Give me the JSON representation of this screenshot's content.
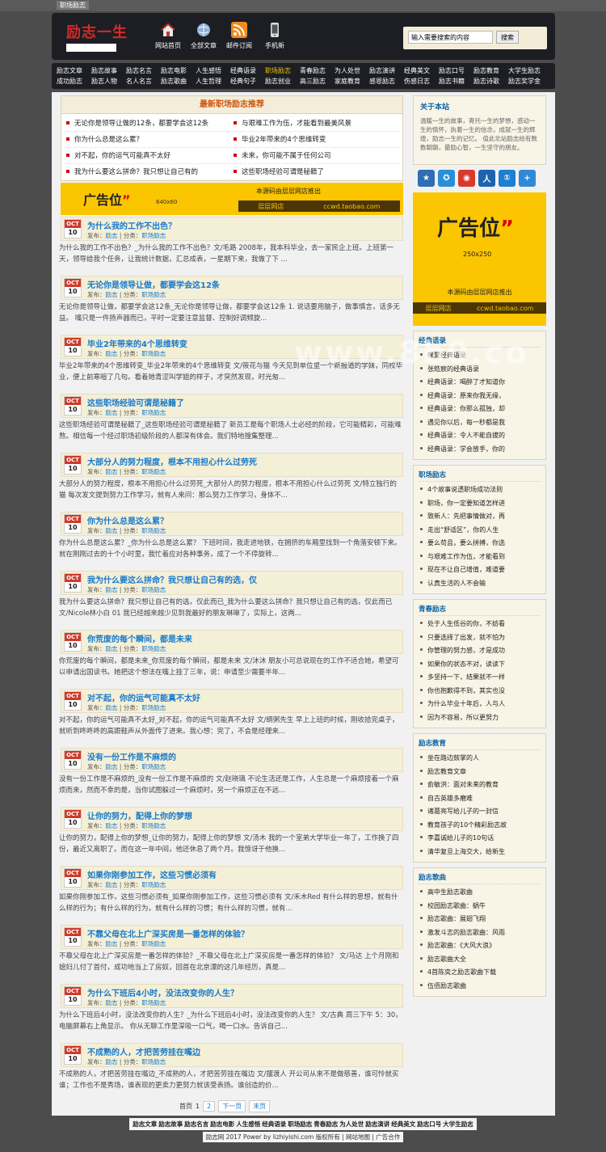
{
  "window": {
    "title": "职场励志"
  },
  "header": {
    "logo_text": "励志一生",
    "nav": [
      {
        "label": "网站首页",
        "icon": "home-icon"
      },
      {
        "label": "全部文章",
        "icon": "globe-icon"
      },
      {
        "label": "邮件订阅",
        "icon": "rss-icon"
      },
      {
        "label": "手机新",
        "icon": "phone-icon"
      }
    ],
    "search": {
      "placeholder": "输入需要搜索的内容",
      "button": "搜索"
    }
  },
  "menu": {
    "row1": [
      "励志文章",
      "励志故事",
      "励志名言",
      "励志电影",
      "人生感悟",
      "经典语录",
      "职场励志",
      "青春励志",
      "为人处世",
      "励志演讲",
      "经典美文",
      "励志口号",
      "励志教育",
      "大学生励志"
    ],
    "row2": [
      "成功励志",
      "励志人物",
      "名人名言",
      "励志歌曲",
      "人生哲理",
      "经典句子",
      "励志创业",
      "高三励志",
      "家庭教育",
      "感恩励志",
      "伤感日志",
      "励志书籍",
      "励志诗歌",
      "励志奖学金"
    ],
    "active": "职场励志"
  },
  "recommend": {
    "title": "最新职场励志推荐",
    "items": [
      "无论你是领导让做的12条，都要学会这12条",
      "与艰难工作为伍，才能看到最美风景",
      "你为什么总是这么累？",
      "毕业2年带来的4个思维转变",
      "对不起，你的运气可能真不太好",
      "未来，你可能不属于任何公司",
      "我为什么要这么拼命？我只想让自己有的",
      "这些职场经验可谓是秘籍了"
    ]
  },
  "ad_banner": {
    "big": "广告位",
    "size": "640x60",
    "text": "本源码由层层网店推出",
    "shop": "层层网店",
    "url": "ccwd.taobao.com"
  },
  "posts": [
    {
      "month": "OCT",
      "day": "10",
      "title": "为什么我的工作不出色？",
      "author": "励志",
      "category": "职场励志",
      "excerpt": "为什么我的工作不出色？_为什么我的工作不出色？文/毛路 2008年，我本科毕业，去一家民企上班。上班第一天，领导给我个任务，让我统计数据，汇总成表，一星期下来，我做了下 ..."
    },
    {
      "month": "OCT",
      "day": "10",
      "title": "无论你是领导让做，都要学会这12条",
      "author": "励志",
      "category": "职场励志",
      "excerpt": "无论你是领导让做，都要学会这12条_无论你是领导让做，都要学会这12条 1. 说话要用脑子，做事慎言，话多无益。 嘴只是一件扬声器而已，平时一定要注意监督、控制好调频旋..."
    },
    {
      "month": "OCT",
      "day": "10",
      "title": "毕业2年带来的4个思维转变",
      "author": "励志",
      "category": "职场励志",
      "excerpt": "毕业2年带来的4个思维转变_毕业2年带来的4个思维转变 文/筱花与猫 今天见到单位里一个新报道的学妹，同校毕业，便上前寒暄了几句。看着她青涩叫学姐的样子，才突然发现，时光匆..."
    },
    {
      "month": "OCT",
      "day": "10",
      "title": "这些职场经验可谓是秘籍了",
      "author": "励志",
      "category": "职场励志",
      "excerpt": "这些职场经验可谓是秘籍了_这些职场经验可谓是秘籍了 新员工是每个职场人士必经的阶段，它可能精彩，可能难熬。相信每一个经过职场初级阶段的人都深有体会。我们特地搜集整理..."
    },
    {
      "month": "OCT",
      "day": "10",
      "title": "大部分人的努力程度，根本不用担心什么过劳死",
      "author": "励志",
      "category": "职场励志",
      "excerpt": "大部分人的努力程度，根本不用担心什么过劳死_大部分人的努力程度，根本不用担心什么过劳死 文/特立独行的猫 每次发文提到努力工作学习，就有人来问：那么努力工作学习，身体不..."
    },
    {
      "month": "OCT",
      "day": "10",
      "title": "你为什么总是这么累？",
      "author": "励志",
      "category": "职场励志",
      "excerpt": "你为什么总是这么累？_你为什么总是这么累？ 下班时间，我走进地铁，在拥挤的车厢里找到一个角落安顿下来。就在刚刚过去的十个小时里，我忙着应对各种事务，成了一个不停旋转..."
    },
    {
      "month": "OCT",
      "day": "10",
      "title": "我为什么要这么拼命？我只想让自己有的选，仅",
      "author": "励志",
      "category": "职场励志",
      "excerpt": "我为什么要这么拼命？我只想让自己有的选，仅此而已_我为什么要这么拼命？我只想让自己有的选，仅此而已 文/Nicole林小白 01 我已经越来越少见到我最好的朋友琳琳了，实际上，这两..."
    },
    {
      "month": "OCT",
      "day": "10",
      "title": "你荒废的每个瞬间，都是未来",
      "author": "励志",
      "category": "职场励志",
      "excerpt": "你荒废的每个瞬间，都是未来_你荒废的每个瞬间，都是未来 文/沐沐 朋友小可总说现在的工作不适合她，希望可以申请出国读书。她把这个想法在嘴上挂了三年，说：申请至少需要半年..."
    },
    {
      "month": "OCT",
      "day": "10",
      "title": "对不起，你的运气可能真不太好",
      "author": "励志",
      "category": "职场励志",
      "excerpt": "对不起，你的运气可能真不太好_对不起，你的运气可能真不太好 文/纲粥先生 早上上班的时候，刚收拾完桌子，就听到咚咚咚的高跟鞋声从外面传了进来。我心想：完了，不会是经理来..."
    },
    {
      "month": "OCT",
      "day": "10",
      "title": "没有一份工作是不麻烦的",
      "author": "励志",
      "category": "职场励志",
      "excerpt": "没有一份工作是不麻烦的_没有一份工作是不麻烦的 文/赵晓璃 不论生活还是工作，人生总是一个麻烦接着一个麻烦而来，然而不幸的是，当你试图躲过一个麻烦时，另一个麻烦正在不远..."
    },
    {
      "month": "OCT",
      "day": "10",
      "title": "让你的努力，配得上你的梦想",
      "author": "励志",
      "category": "职场励志",
      "excerpt": "让你的努力，配得上你的梦想_让你的努力，配得上你的梦想 文/汤木 我的一个室弟大学毕业一年了，工作换了四份，最近又离职了。而在这一年中间，他还休息了两个月。我惊讶于他换..."
    },
    {
      "month": "OCT",
      "day": "10",
      "title": "如果你刚参加工作，这些习惯必须有",
      "author": "励志",
      "category": "职场励志",
      "excerpt": "如果你刚参加工作，这些习惯必须有_如果你刚参加工作，这些习惯必须有 文/禾木Red 有什么样的思想，就有什么样的行为；有什么样的行为，就有什么样的习惯；有什么样的习惯，就有..."
    },
    {
      "month": "OCT",
      "day": "10",
      "title": "不靠父母在北上广深买房是一番怎样的体验？",
      "author": "励志",
      "category": "职场励志",
      "excerpt": "不靠父母在北上广深买房是一番怎样的体验？_不靠父母在北上广深买房是一番怎样的体验？ 文/马达 上个月刚和媳妇儿付了首付，成功地当上了房奴，回首在北京漂的这几年经历，真是..."
    },
    {
      "month": "OCT",
      "day": "10",
      "title": "为什么下班后4小时，没法改变你的人生？",
      "author": "励志",
      "category": "职场励志",
      "excerpt": "为什么下班后4小时，没法改变你的人生？_为什么下班后4小时，没法改变你的人生？ 文/古典 周三下午 5：30，电脑屏幕右上角显示。 你从无聊工作里深吸一口气，喝一口水。告诉自己..."
    },
    {
      "month": "OCT",
      "day": "10",
      "title": "不成熟的人，才把苦劳挂在嘴边",
      "author": "励志",
      "category": "职场励志",
      "excerpt": "不成熟的人，才把苦劳挂在嘴边_不成熟的人，才把苦劳挂在嘴边 文/摆渡人 开公司从来不是做慈善，谁可怜就买谁；工作也不是秀场，谁表现的更卖力更努力就该受表扬。谁创造的价..."
    }
  ],
  "meta_labels": {
    "author_prefix": "发布：",
    "category_prefix": "分类：",
    "separator": " | "
  },
  "pager": {
    "first": "首页",
    "current": "1",
    "page2": "2",
    "next": "下一页",
    "last": "末页"
  },
  "sidebar": {
    "about": {
      "title": "关于本站",
      "text": "温暖一生的故事，寄托一生的梦想，感动一生的情怀，执着一生的信念，成就一生的辉煌，励志一生的记忆。 值此北站励志给有数数朝朝，最励心智，一生坚守的朋友。"
    },
    "share_icons": [
      {
        "name": "favorite-share-icon",
        "glyph": "★",
        "color": "#2f6db5"
      },
      {
        "name": "qzone-share-icon",
        "glyph": "✪",
        "color": "#2a8fd6"
      },
      {
        "name": "weibo-share-icon",
        "glyph": "◉",
        "color": "#d9392b"
      },
      {
        "name": "renren-share-icon",
        "glyph": "人",
        "color": "#1d63b0"
      },
      {
        "name": "kaixin-share-icon",
        "glyph": "①",
        "color": "#1c7fcf"
      },
      {
        "name": "more-share-icon",
        "glyph": "+",
        "color": "#2f8ad6"
      }
    ],
    "ad": {
      "big": "广告位",
      "size": "250x250",
      "text": "本源码由层层网店推出",
      "shop": "层层网店",
      "url": "ccwd.taobao.com"
    },
    "boxes": [
      {
        "title": "经典语录",
        "items": [
          "咪蒙经典语录",
          "张皓宸的经典语录",
          "经典语录：喝醉了才知道你",
          "经典语录：原来你我无缘，",
          "经典语录：你那么孤独，却",
          "遇见你以后，每一秒都是我",
          "经典语录：令人不能自拔的",
          "经典语录：学会放手，你的"
        ]
      },
      {
        "title": "职场励志",
        "items": [
          "4个故事说透职场成功法则",
          "职场，你一定要知道怎样进",
          "致新人：先把事情做对，再",
          "走出“舒适区”，你的人生",
          "要么苟且，要么拼搏，你选",
          "与艰难工作为伍，才能看到",
          "现在不让自己增值，难道要",
          "认真生活的人不会输"
        ]
      },
      {
        "title": "青春励志",
        "items": [
          "处于人生低谷的你，不妨看",
          "只要选择了出发，就不怕为",
          "你管理的努力感，才是成功",
          "如果你的状态不对，读读下",
          "多坚持一下，结果就不一样",
          "你也抱歉得不到，其实也没",
          "为什么毕业十年后，人与人",
          "因为不容易，所以更努力"
        ]
      },
      {
        "title": "励志教育",
        "items": [
          "坐在路边鼓掌的人",
          "励志教育文章",
          "俞敏洪：面对未来的教育",
          "自古英雄多磨难",
          "诸葛亮写给儿子的一封信",
          "教育孩子的10个精彩励志故",
          "李嘉诚给儿子的10句话",
          "清华复旦上海交大，给新生"
        ]
      },
      {
        "title": "励志歌曲",
        "items": [
          "高中生励志歌曲",
          "校园励志歌曲：蜗牛",
          "励志歌曲：展翅飞翔",
          "激发斗志的励志歌曲：风雨",
          "励志歌曲：《大风大浪》",
          "励志歌曲大全",
          "4首陈奕之励志歌曲下载",
          "伍佰励志歌曲"
        ]
      }
    ]
  },
  "watermark": "www.8b0.co",
  "footer": {
    "links": [
      "励志文章",
      "励志故事",
      "励志名言",
      "励志电影",
      "人生感悟",
      "经典语录",
      "职场励志",
      "青春励志",
      "为人处世",
      "励志演讲",
      "经典美文",
      "励志口号",
      "大学生励志"
    ],
    "copyright": "励志网 2017 Power by lizhiyishi.com 版权所有 | 网站地图 | 广告合作"
  },
  "colors": {
    "accent_blue": "#177acc",
    "brand_red": "#d42a2a",
    "ad_yellow": "#fbc600",
    "header_bg": "#1c1e23",
    "active_menu": "#f3c400"
  }
}
